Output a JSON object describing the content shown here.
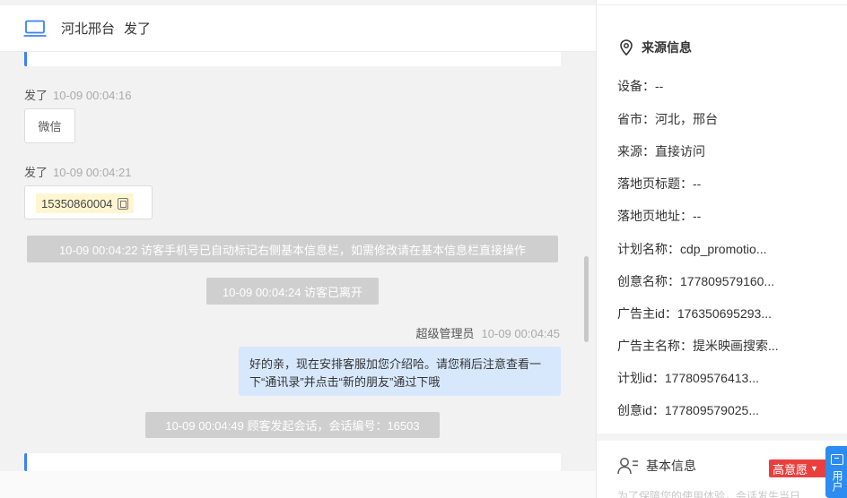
{
  "chat": {
    "header": {
      "location": "河北邢台",
      "name": "发了",
      "icon": "laptop-icon"
    },
    "messages": [
      {
        "who": "发了",
        "time": "10-09 00:04:16",
        "content": "微信"
      },
      {
        "who": "发了",
        "time": "10-09 00:04:21",
        "content": "15350860004",
        "icon": "copy-icon"
      }
    ],
    "system_notices": [
      "10-09 00:04:22 访客手机号已自动标记右侧基本信息栏，如需修改请在基本信息栏直接操作",
      "10-09 00:04:24 访客已离开",
      "10-09 00:04:49 顾客发起会话，会话编号：16503"
    ],
    "agent_message": {
      "who": "超级管理员",
      "time": "10-09 00:04:45",
      "text": "好的亲，现在安排客服加您介绍哈。请您稍后注意查看一下“通讯录”并点击“新的朋友”通过下哦"
    }
  },
  "info": {
    "source_title": "来源信息",
    "source_icon": "location-pin-icon",
    "fields": [
      "设备：--",
      "省市：河北，邢台",
      "来源：直接访问",
      "落地页标题：--",
      "落地页地址：--",
      "计划名称：cdp_promotio...",
      "创意名称：177809579160...",
      "广告主id：176350695293...",
      "广告主名称：提米映画搜索...",
      "计划id：177809576413...",
      "创意id：177809579025..."
    ],
    "basic_title": "基本信息",
    "basic_icon": "user-list-icon",
    "intent_tag": "高意愿",
    "hint": "为了保障您的使用体验，会话发生当日",
    "float_button": "用户"
  },
  "colors": {
    "accent": "#3b82f6",
    "agent_bubble": "#d7e8fd",
    "system_notice": "#cfcfcf",
    "intent_tag": "#e9403f",
    "phone_highlight": "#fff6d1"
  }
}
